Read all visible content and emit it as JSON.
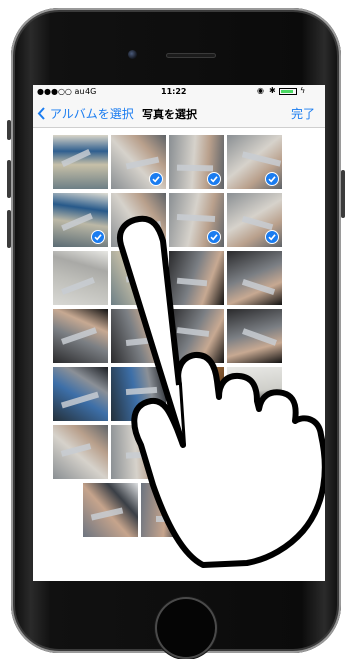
{
  "status": {
    "carrier": "●●●○○ au",
    "network": "4G",
    "time": "11:22"
  },
  "navbar": {
    "back_label": "アルバムを選択",
    "title": "写真を選択",
    "done_label": "完了"
  },
  "colors": {
    "accent": "#1a7cf0",
    "battery": "#4cd964"
  },
  "photos": [
    {
      "label": "workshop",
      "selected": false
    },
    {
      "label": "caliper-hand",
      "selected": true
    },
    {
      "label": "caliper-hand",
      "selected": true
    },
    {
      "label": "caliper-hand",
      "selected": true
    },
    {
      "label": "workshop-table",
      "selected": true
    },
    {
      "label": "caliper-hand",
      "selected": true
    },
    {
      "label": "caliper-hand",
      "selected": true
    },
    {
      "label": "caliper-hand",
      "selected": true
    },
    {
      "label": "paper-chart",
      "selected": false
    },
    {
      "label": "workshop",
      "selected": false
    },
    {
      "label": "caliper-dark",
      "selected": false
    },
    {
      "label": "caliper-dark",
      "selected": false
    },
    {
      "label": "caliper-dark",
      "selected": false
    },
    {
      "label": "caliper-dark",
      "selected": false
    },
    {
      "label": "caliper-dark",
      "selected": false
    },
    {
      "label": "caliper-dark",
      "selected": false
    },
    {
      "label": "micrometer-blue",
      "selected": false
    },
    {
      "label": "micrometer-blue",
      "selected": false
    },
    {
      "label": "wood-tray",
      "selected": false
    },
    {
      "label": "small-part",
      "selected": false
    },
    {
      "label": "caliper-hand",
      "selected": false
    },
    {
      "label": "caliper-hand",
      "selected": false
    },
    {
      "label": "caliper-hand",
      "selected": false
    },
    {
      "label": "caliper-hand",
      "selected": false
    },
    {
      "label": "micrometer-hand",
      "selected": false
    },
    {
      "label": "micrometer-hand",
      "selected": false
    }
  ]
}
